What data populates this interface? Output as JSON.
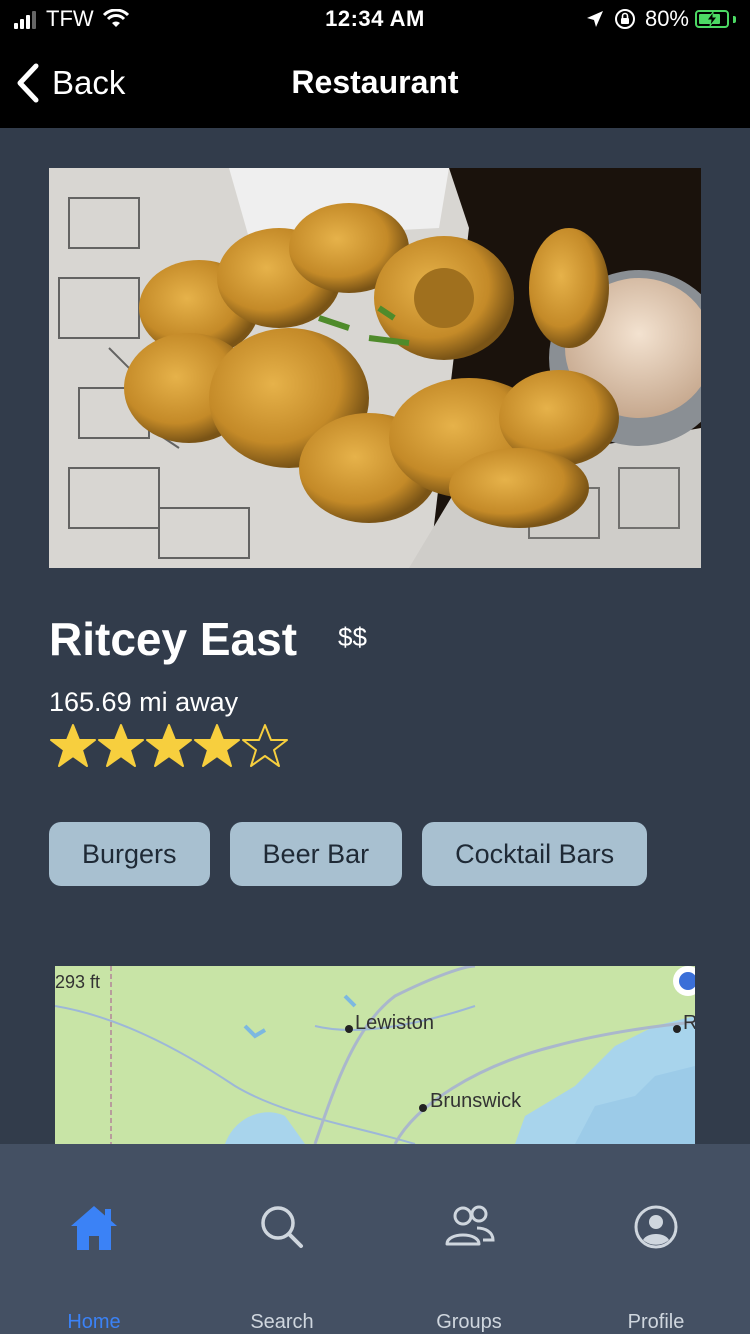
{
  "status_bar": {
    "carrier": "TFW",
    "time": "12:34 AM",
    "battery": "80%",
    "battery_level": 0.8,
    "icons": [
      "signal-icon",
      "wifi-icon",
      "location-arrow-icon",
      "orientation-lock-icon",
      "battery-charging-icon"
    ]
  },
  "nav": {
    "back_label": "Back",
    "title": "Restaurant"
  },
  "restaurant": {
    "photo_alt": "fried-pickles-photo",
    "name": "Ritcey East",
    "price": "$$",
    "distance": "165.69 mi away",
    "rating": 4,
    "rating_max": 5,
    "tags": [
      "Burgers",
      "Beer Bar",
      "Cocktail Bars"
    ]
  },
  "map": {
    "elevation": "293 ft",
    "places": [
      "Lewiston",
      "Brunswick",
      "R"
    ]
  },
  "tabbar": {
    "items": [
      {
        "label": "Home",
        "icon": "home-icon",
        "active": true
      },
      {
        "label": "Search",
        "icon": "search-icon",
        "active": false
      },
      {
        "label": "Groups",
        "icon": "groups-icon",
        "active": false
      },
      {
        "label": "Profile",
        "icon": "profile-icon",
        "active": false
      }
    ],
    "active_color": "#3b82f6"
  },
  "colors": {
    "background": "#323c4b",
    "tag_background": "#a8c0d0",
    "star": "#f7cf3e"
  }
}
